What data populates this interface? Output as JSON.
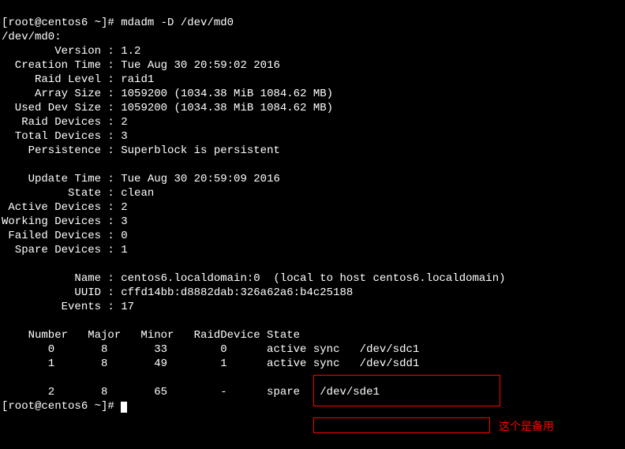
{
  "prompt1": "[root@centos6 ~]# ",
  "cmd": "mdadm -D /dev/md0",
  "device_line": "/dev/md0:",
  "fields": {
    "version_lbl": "        Version : ",
    "version_val": "1.2",
    "creation_lbl": "  Creation Time : ",
    "creation_val": "Tue Aug 30 20:59:02 2016",
    "raidlevel_lbl": "     Raid Level : ",
    "raidlevel_val": "raid1",
    "arraysize_lbl": "     Array Size : ",
    "arraysize_val": "1059200 (1034.38 MiB 1084.62 MB)",
    "useddev_lbl": "  Used Dev Size : ",
    "useddev_val": "1059200 (1034.38 MiB 1084.62 MB)",
    "raiddev_lbl": "   Raid Devices : ",
    "raiddev_val": "2",
    "totaldev_lbl": "  Total Devices : ",
    "totaldev_val": "3",
    "persist_lbl": "    Persistence : ",
    "persist_val": "Superblock is persistent",
    "updtime_lbl": "    Update Time : ",
    "updtime_val": "Tue Aug 30 20:59:09 2016",
    "state_lbl": "          State : ",
    "state_val": "clean",
    "active_lbl": " Active Devices : ",
    "active_val": "2",
    "working_lbl": "Working Devices : ",
    "working_val": "3",
    "failed_lbl": " Failed Devices : ",
    "failed_val": "0",
    "spare_lbl": "  Spare Devices : ",
    "spare_val": "1",
    "name_lbl": "           Name : ",
    "name_val": "centos6.localdomain:0  (local to host centos6.localdomain)",
    "uuid_lbl": "           UUID : ",
    "uuid_val": "cffd14bb:d8882dab:326a62a6:b4c25188",
    "events_lbl": "         Events : ",
    "events_val": "17"
  },
  "table_header": "    Number   Major   Minor   RaidDevice State",
  "rows": [
    "       0       8       33        0      active sync   /dev/sdc1",
    "       1       8       49        1      active sync   /dev/sdd1",
    "",
    "       2       8       65        -      spare   /dev/sde1"
  ],
  "prompt2": "[root@centos6 ~]# ",
  "annotation": "这个是备用"
}
